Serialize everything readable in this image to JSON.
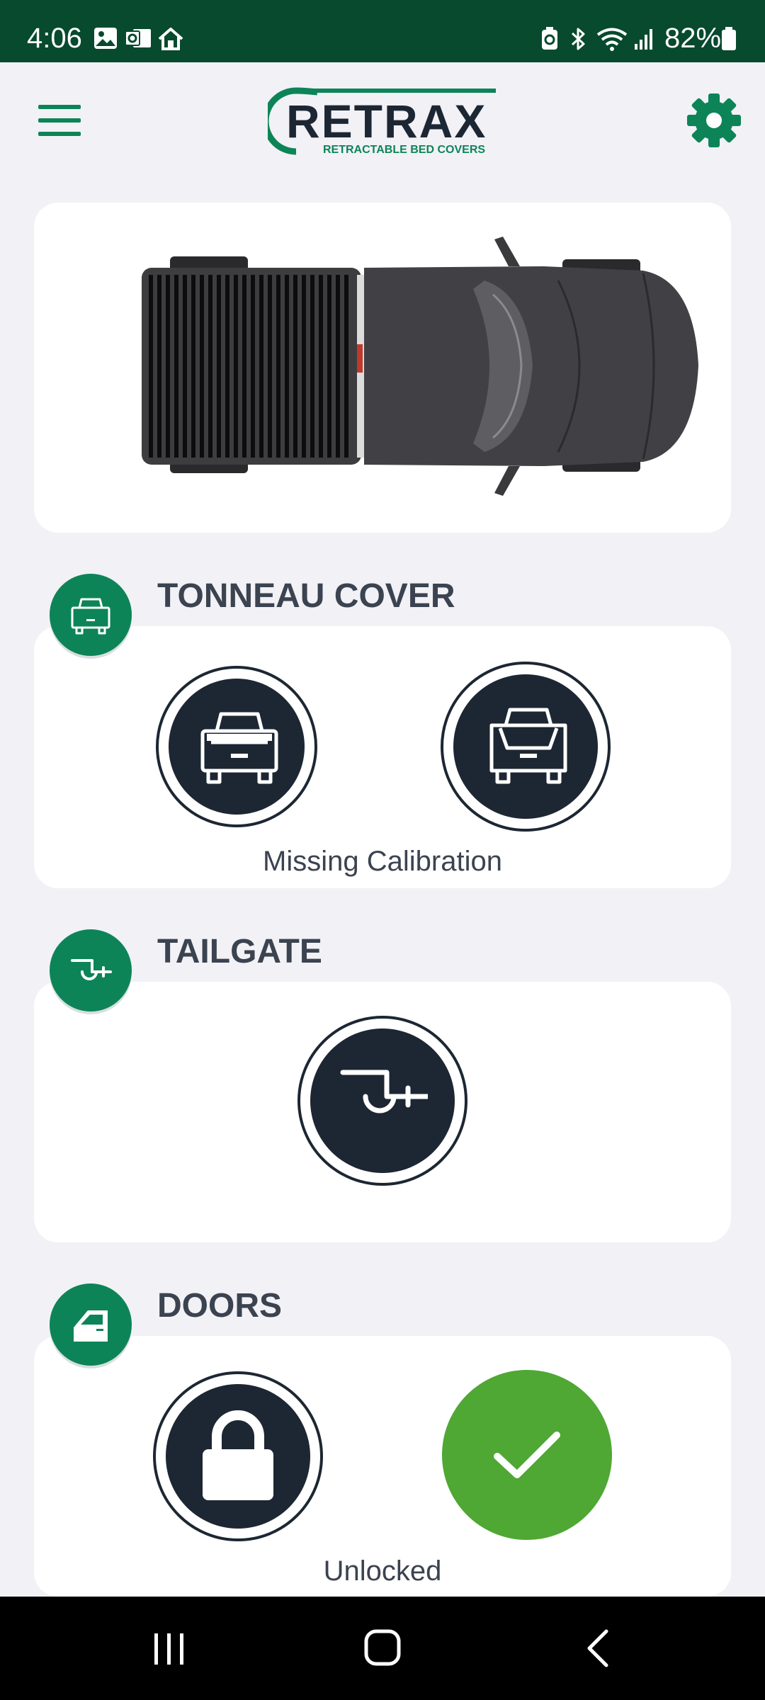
{
  "status_bar": {
    "time": "4:06",
    "battery_percent": "82%"
  },
  "header": {
    "logo_text": "RETRAX",
    "logo_subtext": "RETRACTABLE BED COVERS",
    "menu_icon": "hamburger-menu-icon",
    "settings_icon": "gear-icon"
  },
  "sections": {
    "tonneau": {
      "title": "TONNEAU COVER",
      "status": "Missing Calibration"
    },
    "tailgate": {
      "title": "TAILGATE"
    },
    "doors": {
      "title": "DOORS",
      "status": "Unlocked"
    }
  },
  "colors": {
    "brand_green": "#0d8457",
    "status_bar": "#074a2e",
    "button_dark": "#1d2733",
    "confirm_green": "#4fa734",
    "background": "#f1f1f6"
  }
}
